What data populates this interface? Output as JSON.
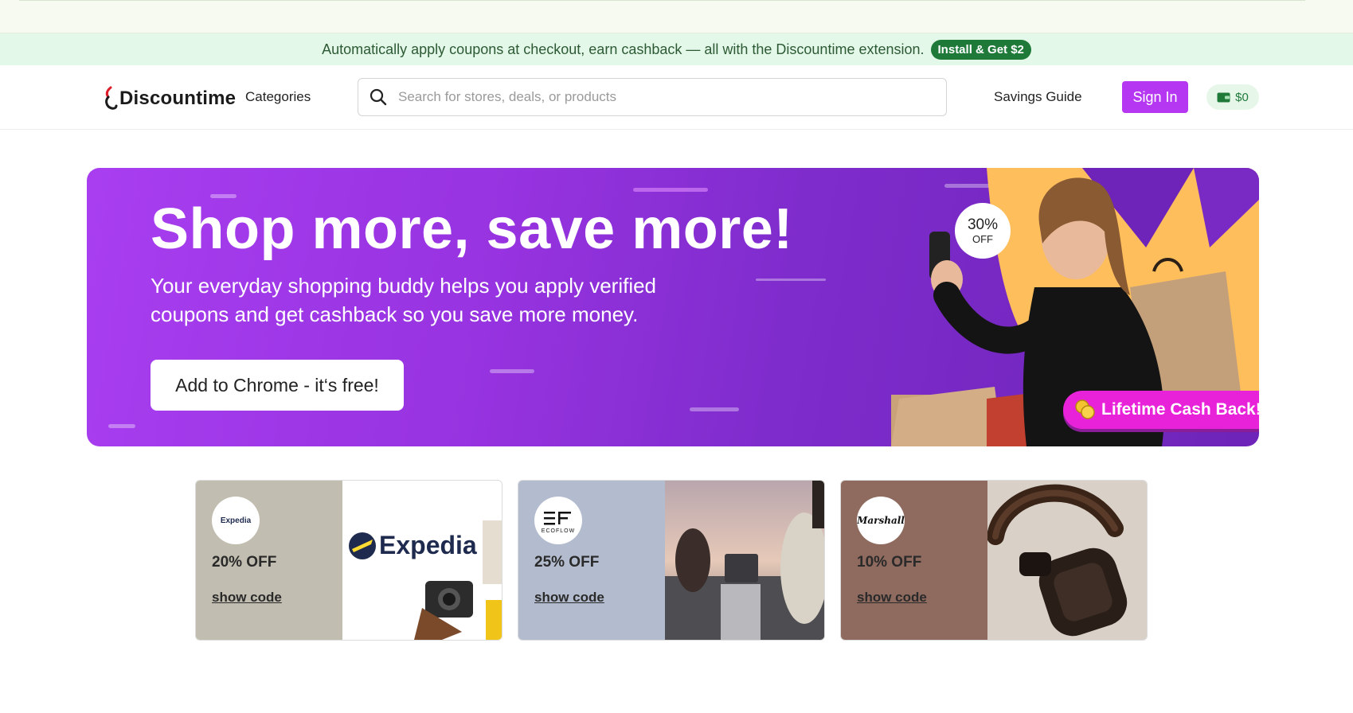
{
  "promo_bar": {
    "text": "Automatically apply coupons at checkout, earn cashback — all with the Discountime extension.",
    "button_label": "Install & Get $2"
  },
  "header": {
    "logo_text": "Discountime",
    "categories_label": "Categories",
    "search_placeholder": "Search for stores, deals, or products",
    "savings_guide_label": "Savings Guide",
    "sign_in_label": "Sign In",
    "wallet_balance": "$0"
  },
  "hero": {
    "title": "Shop more, save more!",
    "subtitle": "Your everyday shopping buddy helps you apply verified coupons and get cashback so you save more money.",
    "cta_label": "Add to Chrome - it‘s free!",
    "badge_percent": "30%",
    "badge_off": "OFF",
    "cashback_label": "Lifetime Cash Back!"
  },
  "deals": [
    {
      "brand": "Expedia",
      "brand_display": "Expedia",
      "discount": "20% OFF",
      "code_label": "show code",
      "panel_color": "#c1bdb0"
    },
    {
      "brand": "EcoFlow",
      "brand_display": "ECOFLOW",
      "discount": "25% OFF",
      "code_label": "show code",
      "panel_color": "#b3bbce"
    },
    {
      "brand": "Marshall",
      "brand_display": "Marshall",
      "discount": "10% OFF",
      "code_label": "show code",
      "panel_color": "#8f6a5e"
    }
  ],
  "colors": {
    "accent": "#b637f1",
    "promo_green": "#1f7a3a",
    "hero_purple": "#9733e0",
    "cashback_pink": "#e822d8"
  }
}
